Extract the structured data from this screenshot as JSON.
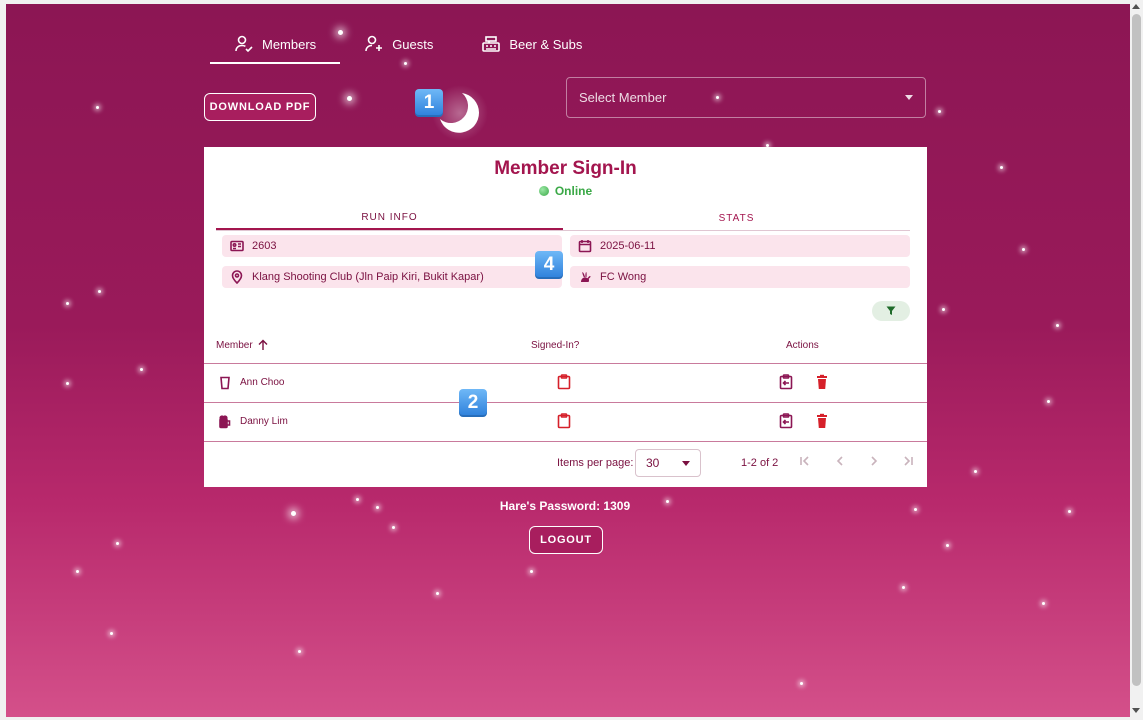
{
  "nav": {
    "tabs": [
      {
        "label": "Members",
        "icon": "person-check-icon",
        "active": true
      },
      {
        "label": "Guests",
        "icon": "person-add-icon",
        "active": false
      },
      {
        "label": "Beer & Subs",
        "icon": "cash-register-icon",
        "active": false
      }
    ]
  },
  "toolbar": {
    "download_label": "DOWNLOAD PDF",
    "select_member_placeholder": "Select Member"
  },
  "badges": {
    "one": "1",
    "two": "2",
    "four": "4"
  },
  "card": {
    "title": "Member Sign-In",
    "status": "Online",
    "tabs": [
      {
        "label": "RUN INFO",
        "active": true
      },
      {
        "label": "STATS",
        "active": false
      }
    ],
    "run_number": "2603",
    "run_date": "2025-06-11",
    "location": "Klang Shooting Club (Jln Paip Kiri, Bukit Kapar)",
    "hare": "FC Wong"
  },
  "table": {
    "headers": {
      "member": "Member",
      "signed_in": "Signed-In?",
      "actions": "Actions"
    },
    "rows": [
      {
        "name": "Ann Choo",
        "icon": "glass-icon"
      },
      {
        "name": "Danny Lim",
        "icon": "beer-mug-icon"
      }
    ]
  },
  "paginator": {
    "items_per_page_label": "Items per page:",
    "items_per_page_value": "30",
    "range": "1-2 of 2"
  },
  "footer": {
    "password": "Hare's Password: 1309",
    "logout_label": "LOGOUT"
  },
  "colors": {
    "primary": "#a3154e",
    "background_top": "#8c1654",
    "background_bottom": "#d4508a",
    "online": "#3aa846",
    "danger": "#d6202a"
  }
}
